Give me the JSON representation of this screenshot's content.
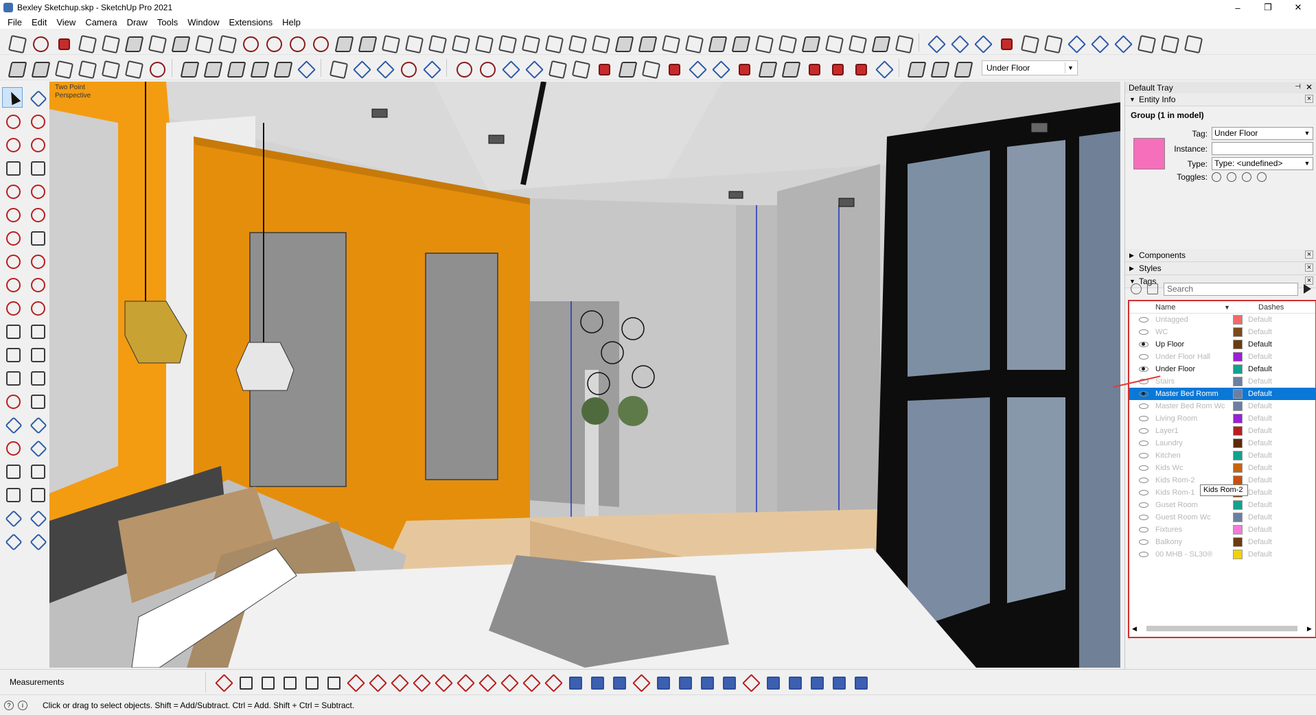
{
  "window": {
    "title": "Bexley Sketchup.skp - SketchUp Pro 2021",
    "minimize": "–",
    "restore": "❐",
    "close": "✕"
  },
  "menu": [
    "File",
    "Edit",
    "View",
    "Camera",
    "Draw",
    "Tools",
    "Window",
    "Extensions",
    "Help"
  ],
  "toolbar": {
    "tag_dropdown_value": "Under Floor"
  },
  "viewport": {
    "camera_label_line1": "Two Point",
    "camera_label_line2": "Perspective"
  },
  "tray": {
    "title": "Default Tray",
    "pin": "⊣",
    "close": "✕",
    "entity_info": {
      "panel_title": "Entity Info",
      "selection": "Group (1 in model)",
      "material_color": "#f66fbb",
      "tag_label": "Tag:",
      "tag_value": "Under Floor",
      "instance_label": "Instance:",
      "instance_value": "",
      "type_label": "Type:",
      "type_value": "Type: <undefined>",
      "toggles_label": "Toggles:"
    },
    "panels": [
      "Components",
      "Styles"
    ],
    "tags": {
      "panel_title": "Tags",
      "search_placeholder": "Search",
      "col_name": "Name",
      "col_dashes": "Dashes",
      "rows": [
        {
          "name": "Untagged",
          "color": "#f06b6b",
          "dashes": "Default",
          "visible": false,
          "selected": false
        },
        {
          "name": "WC",
          "color": "#7a4a1a",
          "dashes": "Default",
          "visible": false,
          "selected": false
        },
        {
          "name": "Up Floor",
          "color": "#6b3c10",
          "dashes": "Default",
          "visible": true,
          "selected": false
        },
        {
          "name": "Under Floor Hall",
          "color": "#9a1fd6",
          "dashes": "Default",
          "visible": false,
          "selected": false
        },
        {
          "name": "Under Floor",
          "color": "#12a18f",
          "dashes": "Default",
          "visible": true,
          "selected": false
        },
        {
          "name": "Stairs",
          "color": "#6d7fa0",
          "dashes": "Default",
          "visible": false,
          "selected": false
        },
        {
          "name": "Master Bed Romm",
          "color": "#6d7fa0",
          "dashes": "Default",
          "visible": true,
          "selected": true
        },
        {
          "name": "Master Bed Rom Wc",
          "color": "#6d7fa0",
          "dashes": "Default",
          "visible": false,
          "selected": false
        },
        {
          "name": "Living Room",
          "color": "#9a1fd6",
          "dashes": "Default",
          "visible": false,
          "selected": false
        },
        {
          "name": "Layer1",
          "color": "#b81e1e",
          "dashes": "Default",
          "visible": false,
          "selected": false
        },
        {
          "name": "Laundry",
          "color": "#5e2a0a",
          "dashes": "Default",
          "visible": false,
          "selected": false
        },
        {
          "name": "Kitchen",
          "color": "#12a18f",
          "dashes": "Default",
          "visible": false,
          "selected": false
        },
        {
          "name": "Kids Wc",
          "color": "#c6640f",
          "dashes": "Default",
          "visible": false,
          "selected": false
        },
        {
          "name": "Kids Rom-2",
          "color": "#c6500f",
          "dashes": "Default",
          "visible": false,
          "selected": false
        },
        {
          "name": "Kids Rom-1",
          "color": "#8a4412",
          "dashes": "Default",
          "visible": false,
          "selected": false
        },
        {
          "name": "Guset Room",
          "color": "#12a18f",
          "dashes": "Default",
          "visible": false,
          "selected": false
        },
        {
          "name": "Guest Room Wc",
          "color": "#6d7fa0",
          "dashes": "Default",
          "visible": false,
          "selected": false
        },
        {
          "name": "Fixtures",
          "color": "#f37bd7",
          "dashes": "Default",
          "visible": false,
          "selected": false
        },
        {
          "name": "Balkony",
          "color": "#6b3c10",
          "dashes": "Default",
          "visible": false,
          "selected": false
        },
        {
          "name": "00 MHB - SL30®",
          "color": "#f0d20e",
          "dashes": "Default",
          "visible": false,
          "selected": false
        }
      ],
      "tooltip": "Kids Rom-2"
    }
  },
  "measurements_label": "Measurements",
  "status_message": "Click or drag to select objects. Shift = Add/Subtract. Ctrl = Add. Shift + Ctrl = Subtract."
}
